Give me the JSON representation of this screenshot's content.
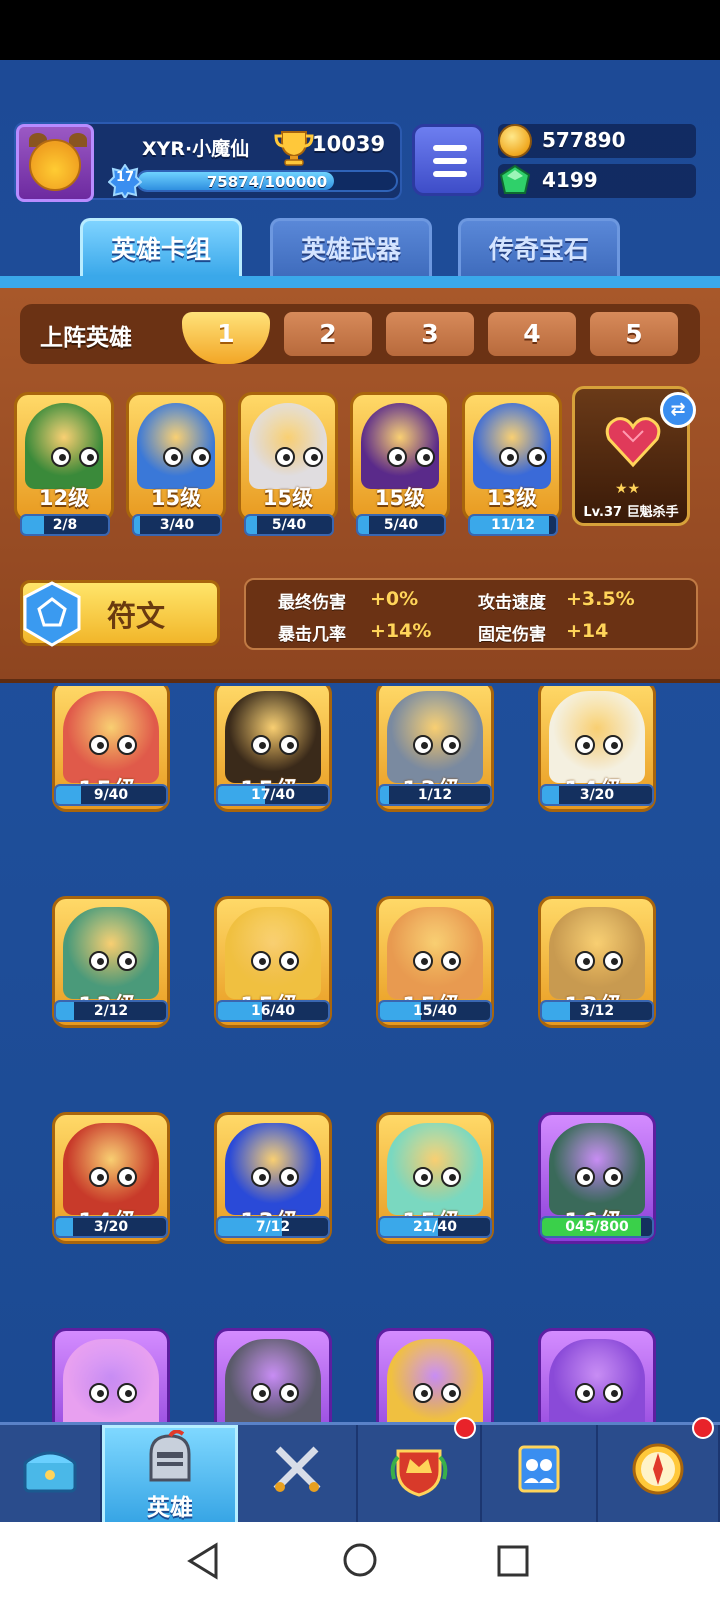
{
  "player": {
    "name": "XYR·小魔仙",
    "trophies": "10039",
    "level": "17",
    "xp_text": "75874/100000",
    "xp_fraction": 0.759
  },
  "currency": {
    "gold": "577890",
    "gems": "4199"
  },
  "tabs": [
    {
      "label": "英雄卡组",
      "active": true
    },
    {
      "label": "英雄武器",
      "active": false
    },
    {
      "label": "传奇宝石",
      "active": false
    }
  ],
  "deck": {
    "label": "上阵英雄",
    "slots": [
      "1",
      "2",
      "3",
      "4",
      "5"
    ],
    "active_slot": 0,
    "heroes": [
      {
        "level": "12级",
        "progress": "2/8",
        "fraction": 0.25,
        "color": "#3a8a3a"
      },
      {
        "level": "15级",
        "progress": "3/40",
        "fraction": 0.075,
        "color": "#3a78d8"
      },
      {
        "level": "15级",
        "progress": "5/40",
        "fraction": 0.125,
        "color": "#e0dde0"
      },
      {
        "level": "15级",
        "progress": "5/40",
        "fraction": 0.125,
        "color": "#5a2a8a"
      },
      {
        "level": "13级",
        "progress": "11/12",
        "fraction": 0.917,
        "color": "#3a6ad8"
      }
    ],
    "weapon": {
      "label": "Lv.37 巨魁杀手",
      "stars": "★★"
    },
    "rune_label": "符文",
    "stats": [
      {
        "name": "最终伤害",
        "value": "+0%"
      },
      {
        "name": "攻击速度",
        "value": "+3.5%"
      },
      {
        "name": "暴击几率",
        "value": "+14%"
      },
      {
        "name": "固定伤害",
        "value": "+14"
      }
    ]
  },
  "collection": [
    {
      "level": "15级",
      "progress": "9/40",
      "fraction": 0.225,
      "color": "#e05a4a",
      "frame": "gold"
    },
    {
      "level": "15级",
      "progress": "17/40",
      "fraction": 0.425,
      "color": "#3a2a1a",
      "frame": "gold"
    },
    {
      "level": "13级",
      "progress": "1/12",
      "fraction": 0.083,
      "color": "#7a8aa0",
      "frame": "gold"
    },
    {
      "level": "14级",
      "progress": "3/20",
      "fraction": 0.15,
      "color": "#f4f0e0",
      "frame": "gold"
    },
    {
      "level": "13级",
      "progress": "2/12",
      "fraction": 0.167,
      "color": "#4a9a7a",
      "frame": "gold"
    },
    {
      "level": "15级",
      "progress": "16/40",
      "fraction": 0.4,
      "color": "#f0c040",
      "frame": "gold"
    },
    {
      "level": "15级",
      "progress": "15/40",
      "fraction": 0.375,
      "color": "#e89a50",
      "frame": "gold"
    },
    {
      "level": "13级",
      "progress": "3/12",
      "fraction": 0.25,
      "color": "#c89a50",
      "frame": "gold"
    },
    {
      "level": "14级",
      "progress": "3/20",
      "fraction": 0.15,
      "color": "#c83a2a",
      "frame": "gold"
    },
    {
      "level": "13级",
      "progress": "7/12",
      "fraction": 0.583,
      "color": "#2a4ad8",
      "frame": "gold"
    },
    {
      "level": "15级",
      "progress": "21/40",
      "fraction": 0.525,
      "color": "#7ad8c0",
      "frame": "gold"
    },
    {
      "level": "16级",
      "progress": "045/800",
      "fraction": 0.9,
      "color": "#3a6a5a",
      "frame": "purple"
    },
    {
      "level": "",
      "progress": "",
      "fraction": 0,
      "color": "#e8a0f0",
      "frame": "purple"
    },
    {
      "level": "",
      "progress": "",
      "fraction": 0,
      "color": "#5a5a6a",
      "frame": "purple"
    },
    {
      "level": "",
      "progress": "",
      "fraction": 0,
      "color": "#f0c040",
      "frame": "purple"
    },
    {
      "level": "",
      "progress": "",
      "fraction": 0,
      "color": "#8a4ad8",
      "frame": "purple"
    }
  ],
  "nav": [
    {
      "icon": "treasure-chest-icon",
      "label": "",
      "active": false,
      "badge": false
    },
    {
      "icon": "knight-helmet-icon",
      "label": "英雄",
      "active": true,
      "badge": false
    },
    {
      "icon": "crossed-swords-icon",
      "label": "",
      "active": false,
      "badge": false
    },
    {
      "icon": "crown-shield-icon",
      "label": "",
      "active": false,
      "badge": true
    },
    {
      "icon": "guild-banner-icon",
      "label": "",
      "active": false,
      "badge": false
    },
    {
      "icon": "compass-icon",
      "label": "",
      "active": false,
      "badge": true
    }
  ]
}
